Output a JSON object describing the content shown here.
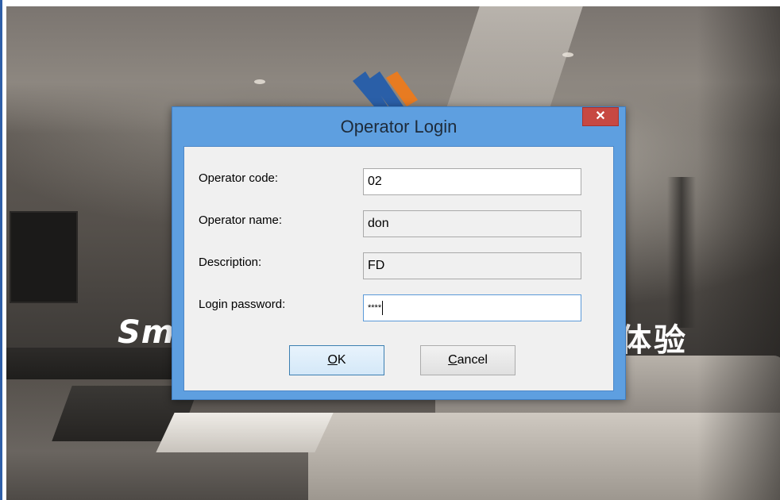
{
  "background": {
    "splash_text_left": "Sm",
    "splash_text_right": "体验"
  },
  "dialog": {
    "title": "Operator Login",
    "close_glyph": "✕",
    "fields": [
      {
        "label": "Operator code:",
        "value": "02",
        "editable": true
      },
      {
        "label": "Operator name:",
        "value": "don",
        "editable": false
      },
      {
        "label": "Description:",
        "value": "FD",
        "editable": false
      },
      {
        "label": "Login password:",
        "value": "****",
        "editable": true,
        "focused": true
      }
    ],
    "buttons": {
      "ok": {
        "mnemonic": "O",
        "rest": "K"
      },
      "cancel": {
        "mnemonic": "C",
        "rest": "ancel"
      }
    }
  },
  "colors": {
    "dialog_frame": "#5e9fe0",
    "close_button": "#c74842",
    "logo_blue": "#2a5fa8",
    "logo_orange": "#e87b21"
  },
  "icons": {
    "close": "close-icon",
    "logo": "app-logo"
  }
}
